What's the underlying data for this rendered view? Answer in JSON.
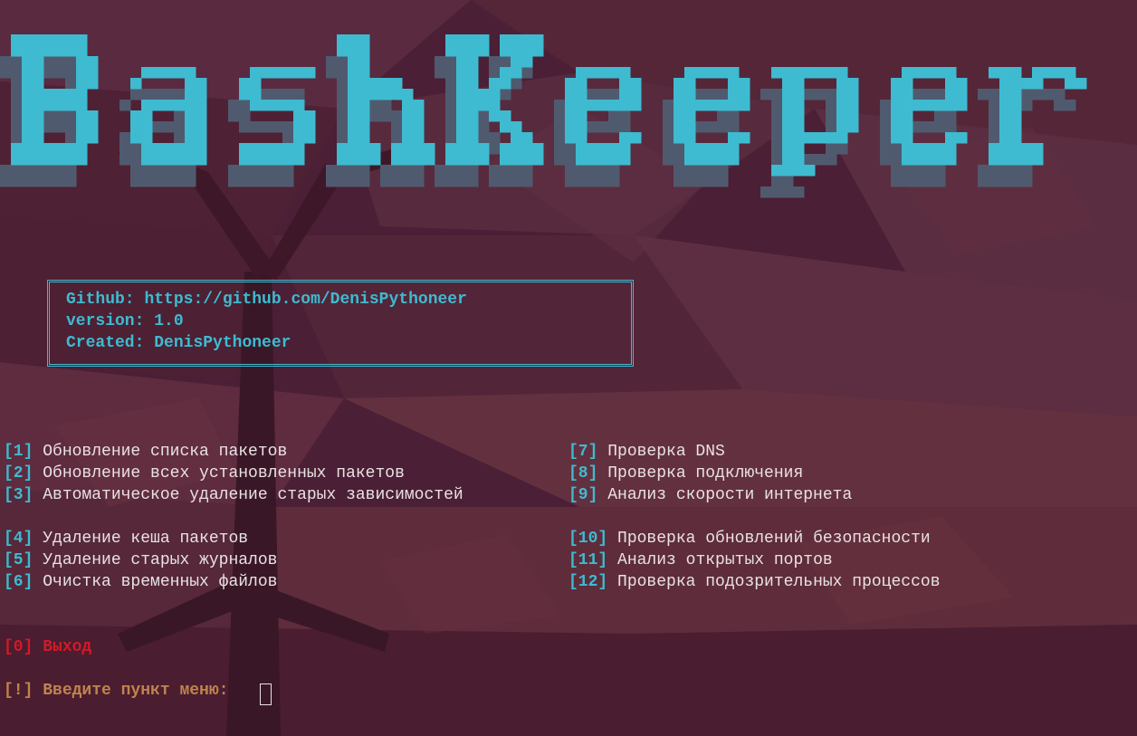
{
  "banner": {
    "title": "BashKeeper",
    "color": "#3ebbd0",
    "shadow_color": "#505a6e"
  },
  "info": {
    "github_label": "Github:",
    "github_url": "https://github.com/DenisPythoneer",
    "version_label": "version:",
    "version": "1.0",
    "created_label": "Created:",
    "author": "DenisPythoneer"
  },
  "menu": {
    "left": [
      {
        "num": "[1]",
        "label": "Обновление списка пакетов"
      },
      {
        "num": "[2]",
        "label": "Обновление всех установленных пакетов"
      },
      {
        "num": "[3]",
        "label": "Автоматическое удаление старых зависимостей"
      },
      {
        "num": "[4]",
        "label": "Удаление кеша пакетов"
      },
      {
        "num": "[5]",
        "label": "Удаление старых журналов"
      },
      {
        "num": "[6]",
        "label": "Очистка временных файлов"
      }
    ],
    "right": [
      {
        "num": "[7]",
        "label": "Проверка DNS"
      },
      {
        "num": "[8]",
        "label": "Проверка подключения"
      },
      {
        "num": "[9]",
        "label": "Анализ скорости интернета"
      },
      {
        "num": "[10]",
        "label": "Проверка обновлений безопасности"
      },
      {
        "num": "[11]",
        "label": "Анализ открытых портов"
      },
      {
        "num": "[12]",
        "label": "Проверка подозрительных процессов"
      }
    ]
  },
  "exit": {
    "num": "[0]",
    "label": "Выход"
  },
  "prompt": {
    "marker": "[!]",
    "label": "Введите пункт меню:"
  },
  "colors": {
    "accent": "#3ebbd0",
    "exit": "#d01a28",
    "prompt": "#c0834d",
    "text": "#e8e2e2",
    "background": "#4a1f33"
  }
}
